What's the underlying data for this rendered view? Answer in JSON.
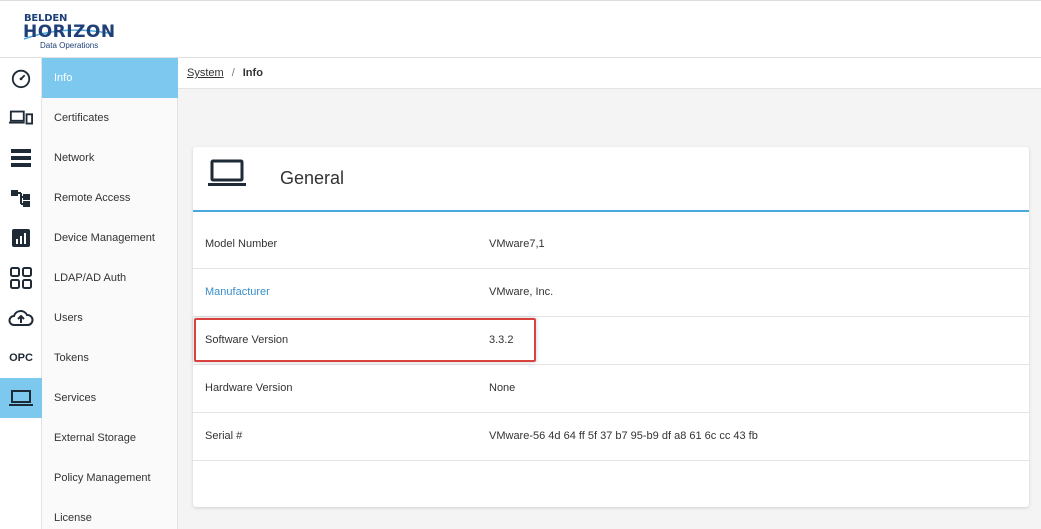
{
  "header": {
    "brand": "BELDEN",
    "product": "HORIZON",
    "tagline": "Data Operations"
  },
  "rail": {
    "items": [
      {
        "icon": "dashboard-gauge-icon"
      },
      {
        "icon": "devices-icon"
      },
      {
        "icon": "server-list-icon"
      },
      {
        "icon": "topology-icon"
      },
      {
        "icon": "reports-chart-icon"
      },
      {
        "icon": "apps-grid-icon"
      },
      {
        "icon": "cloud-upload-icon"
      },
      {
        "icon": "opc-text-icon",
        "label": "OPC"
      },
      {
        "icon": "laptop-icon",
        "active": true
      }
    ]
  },
  "subnav": {
    "items": [
      {
        "label": "Info",
        "active": true
      },
      {
        "label": "Certificates"
      },
      {
        "label": "Network"
      },
      {
        "label": "Remote Access"
      },
      {
        "label": "Device Management"
      },
      {
        "label": "LDAP/AD Auth"
      },
      {
        "label": "Users"
      },
      {
        "label": "Tokens"
      },
      {
        "label": "Services"
      },
      {
        "label": "External Storage"
      },
      {
        "label": "Policy Management"
      },
      {
        "label": "License"
      }
    ]
  },
  "breadcrumb": {
    "parent": "System",
    "separator": "/",
    "current": "Info"
  },
  "card": {
    "icon": "laptop-icon",
    "title": "General",
    "rows": [
      {
        "label": "Model Number",
        "value": "VMware7,1"
      },
      {
        "label": "Manufacturer",
        "value": "VMware, Inc."
      },
      {
        "label": "Software Version",
        "value": "3.3.2"
      },
      {
        "label": "Hardware Version",
        "value": "None"
      },
      {
        "label": "Serial #",
        "value": "VMware-56 4d 64 ff 5f 37 b7 95-b9 df a8 61 6c cc 43 fb"
      }
    ]
  },
  "colors": {
    "accent": "#7cc8ef",
    "header_rule": "#4aa8dc",
    "link": "#3a8fc9",
    "highlight": "#d9433f",
    "brand": "#1e3f78"
  }
}
